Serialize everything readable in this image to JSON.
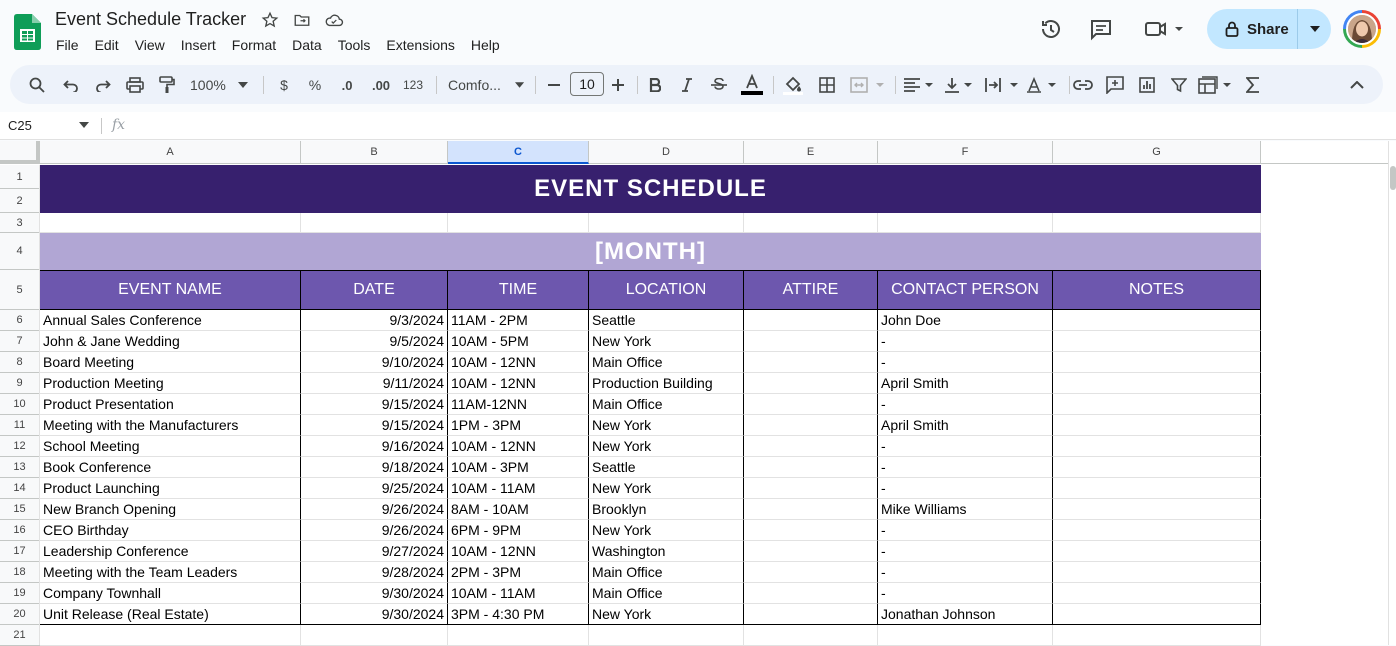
{
  "app": {
    "doc_title": "Event Schedule Tracker",
    "menu": [
      "File",
      "Edit",
      "View",
      "Insert",
      "Format",
      "Data",
      "Tools",
      "Extensions",
      "Help"
    ],
    "share_label": "Share"
  },
  "toolbar": {
    "zoom": "100%",
    "currency": "$",
    "percent": "%",
    "dec_decrease": ".0",
    "dec_increase": ".00",
    "number_format": "123",
    "font": "Comfo...",
    "font_size": "10"
  },
  "formula_bar": {
    "name_box": "C25",
    "fx": "fx",
    "content": ""
  },
  "columns": [
    "A",
    "B",
    "C",
    "D",
    "E",
    "F",
    "G"
  ],
  "selected_column": "C",
  "row_numbers": [
    "1",
    "2",
    "3",
    "4",
    "5",
    "6",
    "7",
    "8",
    "9",
    "10",
    "11",
    "12",
    "13",
    "14",
    "15",
    "16",
    "17",
    "18",
    "19",
    "20",
    "21"
  ],
  "sheet": {
    "title": "EVENT SCHEDULE",
    "month": "[MONTH]",
    "headers": [
      "EVENT NAME",
      "DATE",
      "TIME",
      "LOCATION",
      "ATTIRE",
      "CONTACT PERSON",
      "NOTES"
    ],
    "rows": [
      [
        "Annual Sales Conference",
        "9/3/2024",
        "11AM - 2PM",
        "Seattle",
        "",
        "John Doe",
        ""
      ],
      [
        "John & Jane Wedding",
        "9/5/2024",
        "10AM - 5PM",
        "New York",
        "",
        "-",
        ""
      ],
      [
        "Board Meeting",
        "9/10/2024",
        "10AM - 12NN",
        "Main Office",
        "",
        "-",
        ""
      ],
      [
        "Production Meeting",
        "9/11/2024",
        "10AM - 12NN",
        "Production Building",
        "",
        "April Smith",
        ""
      ],
      [
        "Product Presentation",
        "9/15/2024",
        "11AM-12NN",
        "Main Office",
        "",
        "-",
        ""
      ],
      [
        "Meeting with the Manufacturers",
        "9/15/2024",
        "1PM - 3PM",
        "New York",
        "",
        "April Smith",
        ""
      ],
      [
        "School Meeting",
        "9/16/2024",
        "10AM - 12NN",
        "New York",
        "",
        "-",
        ""
      ],
      [
        "Book Conference",
        "9/18/2024",
        "10AM - 3PM",
        "Seattle",
        "",
        "-",
        ""
      ],
      [
        "Product Launching",
        "9/25/2024",
        "10AM - 11AM",
        "New York",
        "",
        "-",
        ""
      ],
      [
        "New Branch Opening",
        "9/26/2024",
        "8AM - 10AM",
        "Brooklyn",
        "",
        "Mike Williams",
        ""
      ],
      [
        "CEO Birthday",
        "9/26/2024",
        "6PM - 9PM",
        "New York",
        "",
        "-",
        ""
      ],
      [
        "Leadership Conference",
        "9/27/2024",
        "10AM - 12NN",
        "Washington",
        "",
        "-",
        ""
      ],
      [
        "Meeting with the Team Leaders",
        "9/28/2024",
        "2PM - 3PM",
        "Main Office",
        "",
        "-",
        ""
      ],
      [
        "Company Townhall",
        "9/30/2024",
        "10AM - 11AM",
        "Main Office",
        "",
        "-",
        ""
      ],
      [
        "Unit Release (Real Estate)",
        "9/30/2024",
        "3PM - 4:30 PM",
        "New York",
        "",
        "Jonathan Johnson",
        ""
      ]
    ]
  },
  "colors": {
    "title_band": "#37206e",
    "month_band": "#b1a6d4",
    "header_band": "#6d57ae",
    "share_button": "#c2e7ff"
  }
}
